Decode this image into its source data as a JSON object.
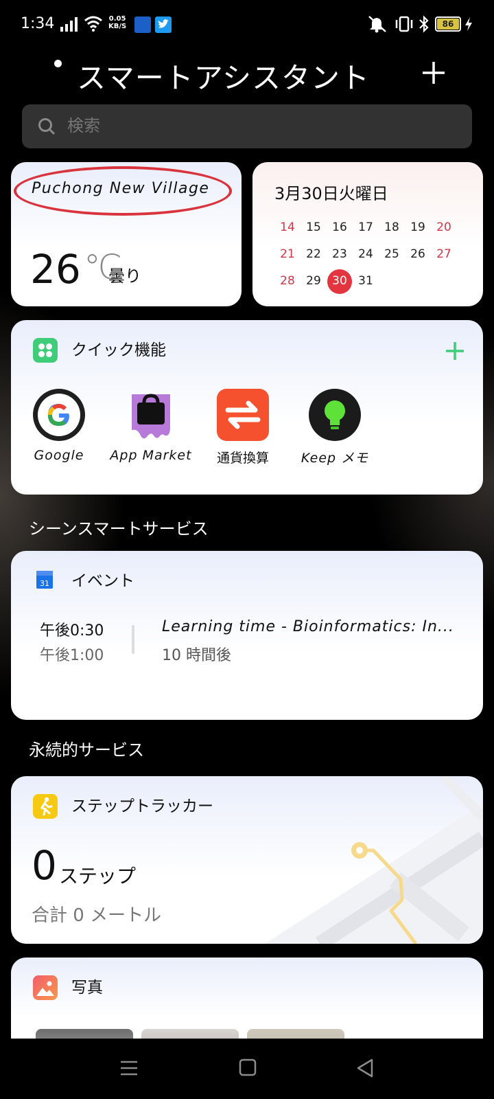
{
  "status_bar": {
    "time": "1:34",
    "net_speed_value": "0.05",
    "net_speed_unit": "KB/S",
    "battery": "86"
  },
  "header": {
    "title": "スマートアシスタント"
  },
  "search": {
    "placeholder": "検索"
  },
  "weather": {
    "location": "Puchong New Village",
    "temperature": "26",
    "unit": "℃",
    "condition": "曇り"
  },
  "calendar": {
    "date": "3月30日火曜日",
    "weeks": [
      [
        "14",
        "15",
        "16",
        "17",
        "18",
        "19",
        "20"
      ],
      [
        "21",
        "22",
        "23",
        "24",
        "25",
        "26",
        "27"
      ],
      [
        "28",
        "29",
        "30",
        "31"
      ]
    ],
    "today": "30"
  },
  "quick": {
    "title": "クイック機能",
    "apps": [
      {
        "label": "Google"
      },
      {
        "label": "App Market"
      },
      {
        "label": "通貨換算"
      },
      {
        "label": "Keep メモ"
      }
    ]
  },
  "scene_section": {
    "title": "シーンスマートサービス"
  },
  "event": {
    "title": "イベント",
    "start": "午後0:30",
    "end": "午後1:00",
    "name": "Learning time - Bioinformatics: In...",
    "relative": "10 時間後"
  },
  "permanent_section": {
    "title": "永続的サービス"
  },
  "steps": {
    "title": "ステップトラッカー",
    "count": "0",
    "unit": "ステップ",
    "total": "合計 0 メートル"
  },
  "photos": {
    "title": "写真"
  },
  "colors": {
    "accent_green": "#3fcd7a",
    "today_red": "#e2353f",
    "weekend_red": "#d23545",
    "step_yellow": "#f6c913"
  }
}
